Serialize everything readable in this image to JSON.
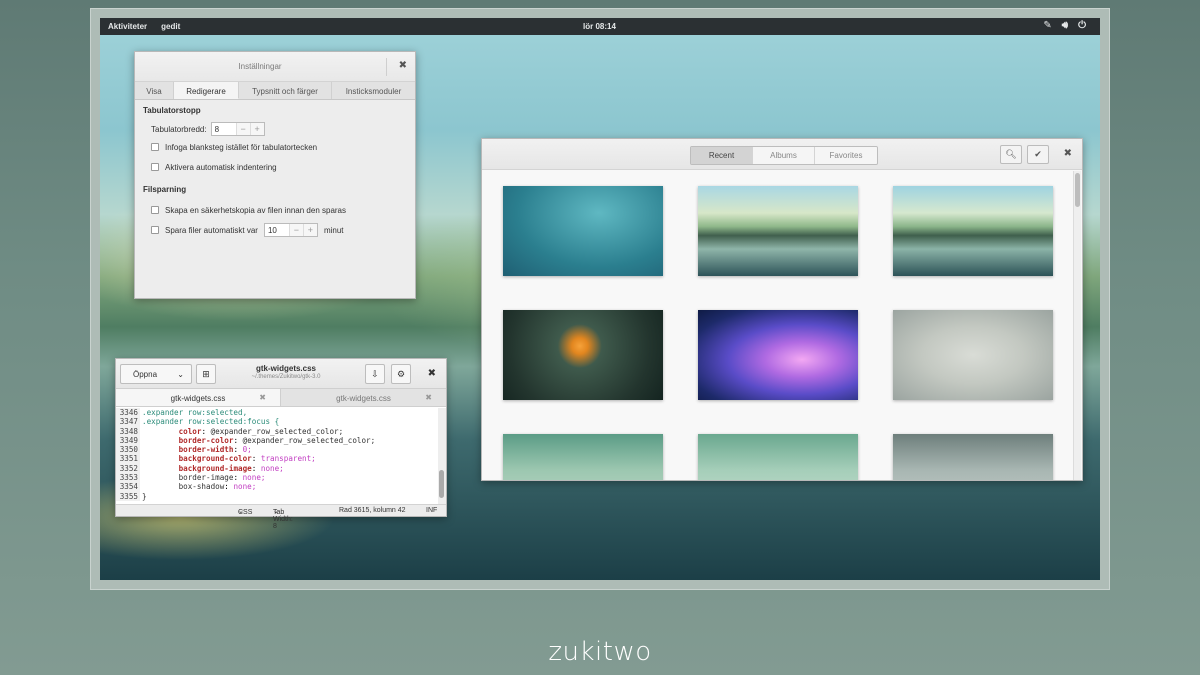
{
  "topbar": {
    "activities": "Aktiviteter",
    "app": "gedit",
    "clock": "lör 08:14"
  },
  "prefs": {
    "title": "Inställningar",
    "tabs": [
      "Visa",
      "Redigerare",
      "Typsnitt och färger",
      "Insticksmoduler"
    ],
    "active_tab": "Redigerare",
    "tab_section": "Tabulatorstopp",
    "tab_width_label": "Tabulatorbredd:",
    "tab_width_value": "8",
    "insert_spaces": "Infoga blanksteg istället för tabulatortecken",
    "auto_indent": "Aktivera automatisk indentering",
    "save_section": "Filsparning",
    "backup": "Skapa en säkerhetskopia av filen innan den sparas",
    "autosave": "Spara filer automatiskt var",
    "autosave_value": "10",
    "autosave_unit": "minut"
  },
  "photos": {
    "tabs": [
      "Recent",
      "Albums",
      "Favorites"
    ],
    "active_tab": "Recent"
  },
  "gedit": {
    "open": "Öppna",
    "filename": "gtk-widgets.css",
    "path": "~/.themes/Zukitwo/gtk-3.0",
    "tab1": "gtk-widgets.css",
    "tab2": "gtk-widgets.css",
    "lines": [
      {
        "n": "3346",
        "text": ".expander row:selected,"
      },
      {
        "n": "3347",
        "text": ".expander row:selected:focus {"
      },
      {
        "n": "3348",
        "prop": "color",
        "val": "@expander_row_selected_color;"
      },
      {
        "n": "3349",
        "prop": "border-color",
        "val": "@expander_row_selected_color;"
      },
      {
        "n": "3350",
        "prop": "border-width",
        "val": "0;"
      },
      {
        "n": "3351",
        "prop": "background-color",
        "val": "transparent;"
      },
      {
        "n": "3352",
        "prop": "background-image",
        "val": "none;"
      },
      {
        "n": "3353",
        "prop": "border-image",
        "val": "none;"
      },
      {
        "n": "3354",
        "prop": "box-shadow",
        "val": "none;"
      },
      {
        "n": "3355",
        "text": "}"
      }
    ],
    "status_lang": "CSS",
    "status_tab": "Tab Width: 8",
    "status_pos": "Rad 3615, kolumn 42",
    "status_mode": "INF"
  },
  "brand": "zukitwo"
}
